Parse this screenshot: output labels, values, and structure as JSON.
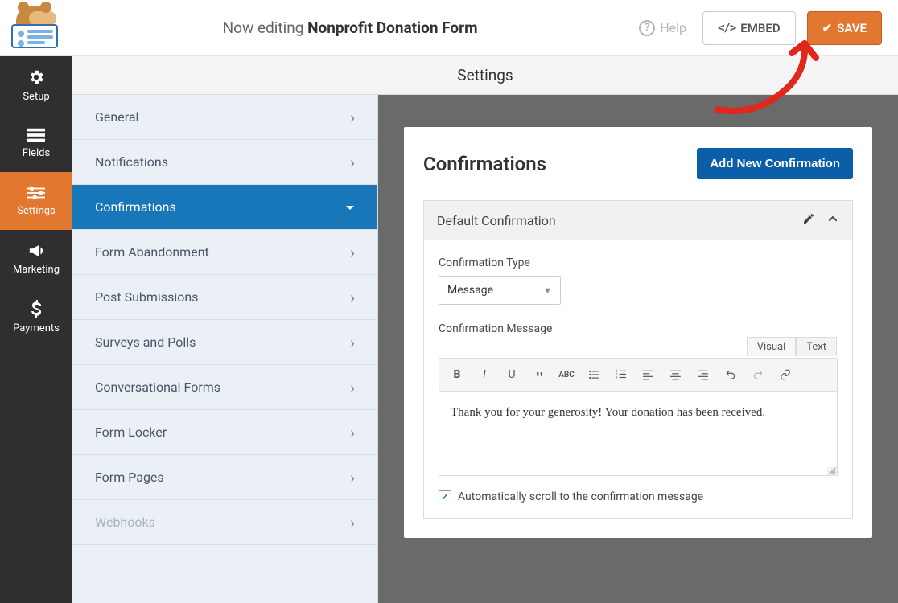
{
  "header": {
    "now_editing_prefix": "Now editing",
    "form_name": "Nonprofit Donation Form",
    "help_label": "Help",
    "embed_label": "EMBED",
    "save_label": "SAVE"
  },
  "rail": {
    "items": [
      {
        "id": "setup",
        "label": "Setup",
        "icon": "gear"
      },
      {
        "id": "fields",
        "label": "Fields",
        "icon": "list"
      },
      {
        "id": "settings",
        "label": "Settings",
        "icon": "sliders",
        "active": true
      },
      {
        "id": "marketing",
        "label": "Marketing",
        "icon": "megaphone"
      },
      {
        "id": "payments",
        "label": "Payments",
        "icon": "dollar"
      }
    ]
  },
  "subheader": {
    "title": "Settings"
  },
  "settings_menu": {
    "items": [
      {
        "label": "General"
      },
      {
        "label": "Notifications"
      },
      {
        "label": "Confirmations",
        "active": true
      },
      {
        "label": "Form Abandonment"
      },
      {
        "label": "Post Submissions"
      },
      {
        "label": "Surveys and Polls"
      },
      {
        "label": "Conversational Forms"
      },
      {
        "label": "Form Locker"
      },
      {
        "label": "Form Pages"
      },
      {
        "label": "Webhooks",
        "disabled": true
      }
    ]
  },
  "panel": {
    "title": "Confirmations",
    "add_button": "Add New Confirmation",
    "confirmation": {
      "name": "Default Confirmation",
      "type_label": "Confirmation Type",
      "type_value": "Message",
      "msg_label": "Confirmation Message",
      "editor_tabs": {
        "visual": "Visual",
        "text": "Text"
      },
      "msg_value": "Thank you for your generosity! Your donation has been received.",
      "auto_scroll_checked": true,
      "auto_scroll_label": "Automatically scroll to the confirmation message"
    }
  }
}
